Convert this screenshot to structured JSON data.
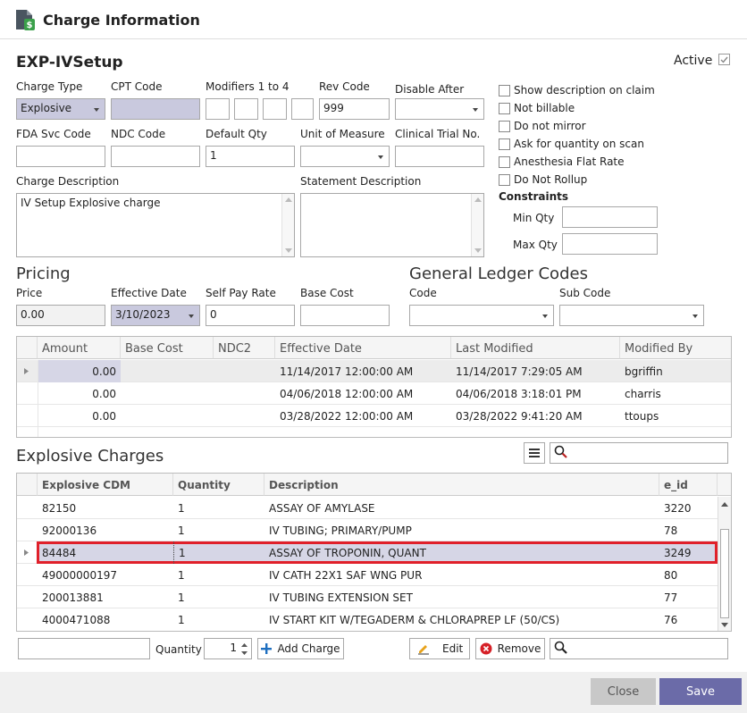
{
  "window": {
    "title": "Charge Information"
  },
  "form": {
    "code": "EXP-IVSetup",
    "active_label": "Active",
    "charge_type": {
      "label": "Charge Type",
      "value": "Explosive"
    },
    "cpt_code": {
      "label": "CPT Code",
      "value": ""
    },
    "modifiers": {
      "label": "Modifiers 1 to 4"
    },
    "rev_code": {
      "label": "Rev Code",
      "value": "999"
    },
    "disable_after": {
      "label": "Disable After",
      "value": ""
    },
    "fda_svc_code": {
      "label": "FDA Svc Code",
      "value": ""
    },
    "ndc_code": {
      "label": "NDC Code",
      "value": ""
    },
    "default_qty": {
      "label": "Default Qty",
      "value": "1"
    },
    "unit_of_measure": {
      "label": "Unit of Measure",
      "value": ""
    },
    "clinical_trial": {
      "label": "Clinical Trial No.",
      "value": ""
    },
    "charge_description": {
      "label": "Charge Description",
      "value": "IV Setup Explosive charge"
    },
    "statement_description": {
      "label": "Statement Description",
      "value": ""
    }
  },
  "options": [
    {
      "label": "Show description on claim"
    },
    {
      "label": "Not billable"
    },
    {
      "label": "Do not mirror"
    },
    {
      "label": "Ask for quantity on scan"
    },
    {
      "label": "Anesthesia Flat Rate"
    },
    {
      "label": "Do Not Rollup"
    }
  ],
  "constraints": {
    "title": "Constraints",
    "min_label": "Min Qty",
    "max_label": "Max Qty"
  },
  "pricing": {
    "title": "Pricing",
    "price": {
      "label": "Price",
      "value": "0.00"
    },
    "effective_date": {
      "label": "Effective Date",
      "value": "3/10/2023"
    },
    "self_pay": {
      "label": "Self Pay Rate",
      "value": "0"
    },
    "base_cost": {
      "label": "Base Cost",
      "value": ""
    }
  },
  "gl": {
    "title": "General Ledger Codes",
    "code_label": "Code",
    "sub_code_label": "Sub Code"
  },
  "price_grid": {
    "columns": [
      "Amount",
      "Base Cost",
      "NDC2",
      "Effective Date",
      "Last Modified",
      "Modified By"
    ],
    "rows": [
      [
        "0.00",
        "",
        "",
        "11/14/2017 12:00:00 AM",
        "11/14/2017 7:29:05 AM",
        "bgriffin"
      ],
      [
        "0.00",
        "",
        "",
        "04/06/2018 12:00:00 AM",
        "04/06/2018 3:18:01 PM",
        "charris"
      ],
      [
        "0.00",
        "",
        "",
        "03/28/2022 12:00:00 AM",
        "03/28/2022 9:41:20 AM",
        "ttoups"
      ]
    ]
  },
  "explosive": {
    "title": "Explosive Charges",
    "columns": [
      "Explosive CDM",
      "Quantity",
      "Description",
      "e_id"
    ],
    "rows": [
      [
        "82150",
        "1",
        "ASSAY OF AMYLASE",
        "3220"
      ],
      [
        "92000136",
        "1",
        "IV TUBING; PRIMARY/PUMP",
        "78"
      ],
      [
        "84484",
        "1",
        "ASSAY OF TROPONIN, QUANT",
        "3249"
      ],
      [
        "49000000197",
        "1",
        "IV CATH 22X1 SAF WNG PUR",
        "80"
      ],
      [
        "200013881",
        "1",
        "IV TUBING EXTENSION SET",
        "77"
      ],
      [
        "4000471088",
        "1",
        "IV START KIT W/TEGADERM & CHLORAPREP LF (50/CS)",
        "76"
      ]
    ]
  },
  "bottom": {
    "quantity_label": "Quantity",
    "quantity_value": "1",
    "add_charge": "Add Charge",
    "edit": "Edit",
    "remove": "Remove"
  },
  "footer": {
    "close": "Close",
    "save": "Save"
  },
  "colors": {
    "accent": "#6b6ba8",
    "selected_row": "#d6d6e6",
    "highlight_border": "#e0202a"
  }
}
